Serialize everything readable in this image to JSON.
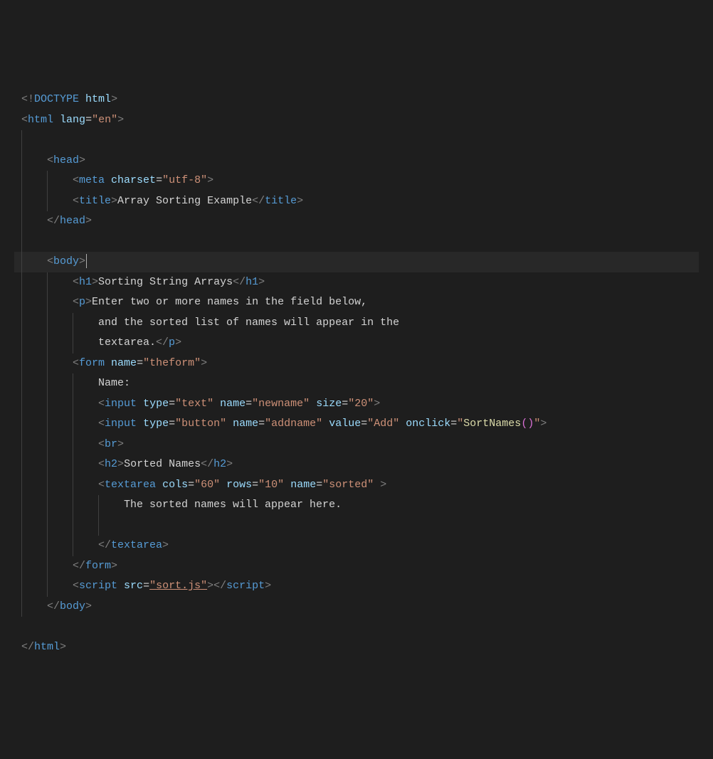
{
  "lines": [
    {
      "indent": 0,
      "guides": [],
      "active": false,
      "tokens": [
        {
          "c": "c-angle",
          "t": "<!"
        },
        {
          "c": "c-doctype",
          "t": "DOCTYPE"
        },
        {
          "c": "c-text",
          "t": " "
        },
        {
          "c": "c-attr",
          "t": "html"
        },
        {
          "c": "c-angle",
          "t": ">"
        }
      ]
    },
    {
      "indent": 0,
      "guides": [],
      "active": false,
      "tokens": [
        {
          "c": "c-angle",
          "t": "<"
        },
        {
          "c": "c-tag",
          "t": "html"
        },
        {
          "c": "c-text",
          "t": " "
        },
        {
          "c": "c-attr",
          "t": "lang"
        },
        {
          "c": "c-eq",
          "t": "="
        },
        {
          "c": "c-str",
          "t": "\"en\""
        },
        {
          "c": "c-angle",
          "t": ">"
        }
      ]
    },
    {
      "indent": 1,
      "guides": [
        0
      ],
      "active": false,
      "tokens": []
    },
    {
      "indent": 1,
      "guides": [
        0
      ],
      "active": false,
      "tokens": [
        {
          "c": "c-angle",
          "t": "<"
        },
        {
          "c": "c-tag",
          "t": "head"
        },
        {
          "c": "c-angle",
          "t": ">"
        }
      ]
    },
    {
      "indent": 2,
      "guides": [
        0,
        1
      ],
      "active": false,
      "tokens": [
        {
          "c": "c-angle",
          "t": "<"
        },
        {
          "c": "c-tag",
          "t": "meta"
        },
        {
          "c": "c-text",
          "t": " "
        },
        {
          "c": "c-attr",
          "t": "charset"
        },
        {
          "c": "c-eq",
          "t": "="
        },
        {
          "c": "c-str",
          "t": "\"utf-8\""
        },
        {
          "c": "c-angle",
          "t": ">"
        }
      ]
    },
    {
      "indent": 2,
      "guides": [
        0,
        1
      ],
      "active": false,
      "tokens": [
        {
          "c": "c-angle",
          "t": "<"
        },
        {
          "c": "c-tag",
          "t": "title"
        },
        {
          "c": "c-angle",
          "t": ">"
        },
        {
          "c": "c-text",
          "t": "Array Sorting Example"
        },
        {
          "c": "c-angle",
          "t": "</"
        },
        {
          "c": "c-tag",
          "t": "title"
        },
        {
          "c": "c-angle",
          "t": ">"
        }
      ]
    },
    {
      "indent": 1,
      "guides": [
        0
      ],
      "active": false,
      "tokens": [
        {
          "c": "c-angle",
          "t": "</"
        },
        {
          "c": "c-tag",
          "t": "head"
        },
        {
          "c": "c-angle",
          "t": ">"
        }
      ]
    },
    {
      "indent": 1,
      "guides": [
        0
      ],
      "active": false,
      "tokens": []
    },
    {
      "indent": 1,
      "guides": [
        0
      ],
      "active": true,
      "cursor": true,
      "tokens": [
        {
          "c": "c-angle",
          "t": "<"
        },
        {
          "c": "c-tag",
          "t": "body"
        },
        {
          "c": "c-angle",
          "t": ">"
        }
      ]
    },
    {
      "indent": 2,
      "guides": [
        0,
        1
      ],
      "active": false,
      "tokens": [
        {
          "c": "c-angle",
          "t": "<"
        },
        {
          "c": "c-tag",
          "t": "h1"
        },
        {
          "c": "c-angle",
          "t": ">"
        },
        {
          "c": "c-text",
          "t": "Sorting String Arrays"
        },
        {
          "c": "c-angle",
          "t": "</"
        },
        {
          "c": "c-tag",
          "t": "h1"
        },
        {
          "c": "c-angle",
          "t": ">"
        }
      ]
    },
    {
      "indent": 2,
      "guides": [
        0,
        1
      ],
      "active": false,
      "tokens": [
        {
          "c": "c-angle",
          "t": "<"
        },
        {
          "c": "c-tag",
          "t": "p"
        },
        {
          "c": "c-angle",
          "t": ">"
        },
        {
          "c": "c-text",
          "t": "Enter two or more names in the field below,"
        }
      ]
    },
    {
      "indent": 3,
      "guides": [
        0,
        1,
        2
      ],
      "active": false,
      "tokens": [
        {
          "c": "c-text",
          "t": "and the sorted list of names will appear in the"
        }
      ]
    },
    {
      "indent": 3,
      "guides": [
        0,
        1,
        2
      ],
      "active": false,
      "tokens": [
        {
          "c": "c-text",
          "t": "textarea."
        },
        {
          "c": "c-angle",
          "t": "</"
        },
        {
          "c": "c-tag",
          "t": "p"
        },
        {
          "c": "c-angle",
          "t": ">"
        }
      ]
    },
    {
      "indent": 2,
      "guides": [
        0,
        1
      ],
      "active": false,
      "tokens": [
        {
          "c": "c-angle",
          "t": "<"
        },
        {
          "c": "c-tag",
          "t": "form"
        },
        {
          "c": "c-text",
          "t": " "
        },
        {
          "c": "c-attr",
          "t": "name"
        },
        {
          "c": "c-eq",
          "t": "="
        },
        {
          "c": "c-str",
          "t": "\"theform\""
        },
        {
          "c": "c-angle",
          "t": ">"
        }
      ]
    },
    {
      "indent": 3,
      "guides": [
        0,
        1,
        2
      ],
      "active": false,
      "tokens": [
        {
          "c": "c-text",
          "t": "Name:"
        }
      ]
    },
    {
      "indent": 3,
      "guides": [
        0,
        1,
        2
      ],
      "active": false,
      "tokens": [
        {
          "c": "c-angle",
          "t": "<"
        },
        {
          "c": "c-tag",
          "t": "input"
        },
        {
          "c": "c-text",
          "t": " "
        },
        {
          "c": "c-attr",
          "t": "type"
        },
        {
          "c": "c-eq",
          "t": "="
        },
        {
          "c": "c-str",
          "t": "\"text\""
        },
        {
          "c": "c-text",
          "t": " "
        },
        {
          "c": "c-attr",
          "t": "name"
        },
        {
          "c": "c-eq",
          "t": "="
        },
        {
          "c": "c-str",
          "t": "\"newname\""
        },
        {
          "c": "c-text",
          "t": " "
        },
        {
          "c": "c-attr",
          "t": "size"
        },
        {
          "c": "c-eq",
          "t": "="
        },
        {
          "c": "c-str",
          "t": "\"20\""
        },
        {
          "c": "c-angle",
          "t": ">"
        }
      ]
    },
    {
      "indent": 3,
      "guides": [
        0,
        1,
        2
      ],
      "active": false,
      "tokens": [
        {
          "c": "c-angle",
          "t": "<"
        },
        {
          "c": "c-tag",
          "t": "input"
        },
        {
          "c": "c-text",
          "t": " "
        },
        {
          "c": "c-attr",
          "t": "type"
        },
        {
          "c": "c-eq",
          "t": "="
        },
        {
          "c": "c-str",
          "t": "\"button\""
        },
        {
          "c": "c-text",
          "t": " "
        },
        {
          "c": "c-attr",
          "t": "name"
        },
        {
          "c": "c-eq",
          "t": "="
        },
        {
          "c": "c-str",
          "t": "\"addname\""
        },
        {
          "c": "c-text",
          "t": " "
        },
        {
          "c": "c-attr",
          "t": "value"
        },
        {
          "c": "c-eq",
          "t": "="
        },
        {
          "c": "c-str",
          "t": "\"Add\""
        },
        {
          "c": "c-text",
          "t": " "
        },
        {
          "c": "c-attr",
          "t": "onclick"
        },
        {
          "c": "c-eq",
          "t": "="
        },
        {
          "c": "c-str",
          "t": "\""
        },
        {
          "c": "c-fn",
          "t": "SortNames"
        },
        {
          "c": "c-paren",
          "t": "()"
        },
        {
          "c": "c-str",
          "t": "\""
        },
        {
          "c": "c-angle",
          "t": ">"
        }
      ]
    },
    {
      "indent": 3,
      "guides": [
        0,
        1,
        2
      ],
      "active": false,
      "tokens": [
        {
          "c": "c-angle",
          "t": "<"
        },
        {
          "c": "c-tag",
          "t": "br"
        },
        {
          "c": "c-angle",
          "t": ">"
        }
      ]
    },
    {
      "indent": 3,
      "guides": [
        0,
        1,
        2
      ],
      "active": false,
      "tokens": [
        {
          "c": "c-angle",
          "t": "<"
        },
        {
          "c": "c-tag",
          "t": "h2"
        },
        {
          "c": "c-angle",
          "t": ">"
        },
        {
          "c": "c-text",
          "t": "Sorted Names"
        },
        {
          "c": "c-angle",
          "t": "</"
        },
        {
          "c": "c-tag",
          "t": "h2"
        },
        {
          "c": "c-angle",
          "t": ">"
        }
      ]
    },
    {
      "indent": 3,
      "guides": [
        0,
        1,
        2
      ],
      "active": false,
      "tokens": [
        {
          "c": "c-angle",
          "t": "<"
        },
        {
          "c": "c-tag",
          "t": "textarea"
        },
        {
          "c": "c-text",
          "t": " "
        },
        {
          "c": "c-attr",
          "t": "cols"
        },
        {
          "c": "c-eq",
          "t": "="
        },
        {
          "c": "c-str",
          "t": "\"60\""
        },
        {
          "c": "c-text",
          "t": " "
        },
        {
          "c": "c-attr",
          "t": "rows"
        },
        {
          "c": "c-eq",
          "t": "="
        },
        {
          "c": "c-str",
          "t": "\"10\""
        },
        {
          "c": "c-text",
          "t": " "
        },
        {
          "c": "c-attr",
          "t": "name"
        },
        {
          "c": "c-eq",
          "t": "="
        },
        {
          "c": "c-str",
          "t": "\"sorted\""
        },
        {
          "c": "c-text",
          "t": " "
        },
        {
          "c": "c-angle",
          "t": ">"
        }
      ]
    },
    {
      "indent": 4,
      "guides": [
        0,
        1,
        2,
        3
      ],
      "active": false,
      "tokens": [
        {
          "c": "c-text",
          "t": "The sorted names will appear here."
        }
      ]
    },
    {
      "indent": 4,
      "guides": [
        0,
        1,
        2,
        3
      ],
      "active": false,
      "tokens": []
    },
    {
      "indent": 3,
      "guides": [
        0,
        1,
        2
      ],
      "active": false,
      "tokens": [
        {
          "c": "c-angle",
          "t": "</"
        },
        {
          "c": "c-tag",
          "t": "textarea"
        },
        {
          "c": "c-angle",
          "t": ">"
        }
      ]
    },
    {
      "indent": 2,
      "guides": [
        0,
        1
      ],
      "active": false,
      "tokens": [
        {
          "c": "c-angle",
          "t": "</"
        },
        {
          "c": "c-tag",
          "t": "form"
        },
        {
          "c": "c-angle",
          "t": ">"
        }
      ]
    },
    {
      "indent": 2,
      "guides": [
        0,
        1
      ],
      "active": false,
      "tokens": [
        {
          "c": "c-angle",
          "t": "<"
        },
        {
          "c": "c-tag",
          "t": "script"
        },
        {
          "c": "c-text",
          "t": " "
        },
        {
          "c": "c-attr",
          "t": "src"
        },
        {
          "c": "c-eq",
          "t": "="
        },
        {
          "c": "c-str underline",
          "t": "\"sort.js\""
        },
        {
          "c": "c-angle",
          "t": "></"
        },
        {
          "c": "c-tag",
          "t": "script"
        },
        {
          "c": "c-angle",
          "t": ">"
        }
      ]
    },
    {
      "indent": 1,
      "guides": [
        0
      ],
      "active": false,
      "tokens": [
        {
          "c": "c-angle",
          "t": "</"
        },
        {
          "c": "c-tag",
          "t": "body"
        },
        {
          "c": "c-angle",
          "t": ">"
        }
      ]
    },
    {
      "indent": 0,
      "guides": [],
      "active": false,
      "tokens": []
    },
    {
      "indent": 0,
      "guides": [],
      "active": false,
      "tokens": [
        {
          "c": "c-angle",
          "t": "</"
        },
        {
          "c": "c-tag",
          "t": "html"
        },
        {
          "c": "c-angle",
          "t": ">"
        }
      ]
    }
  ],
  "indentWidth": 4
}
